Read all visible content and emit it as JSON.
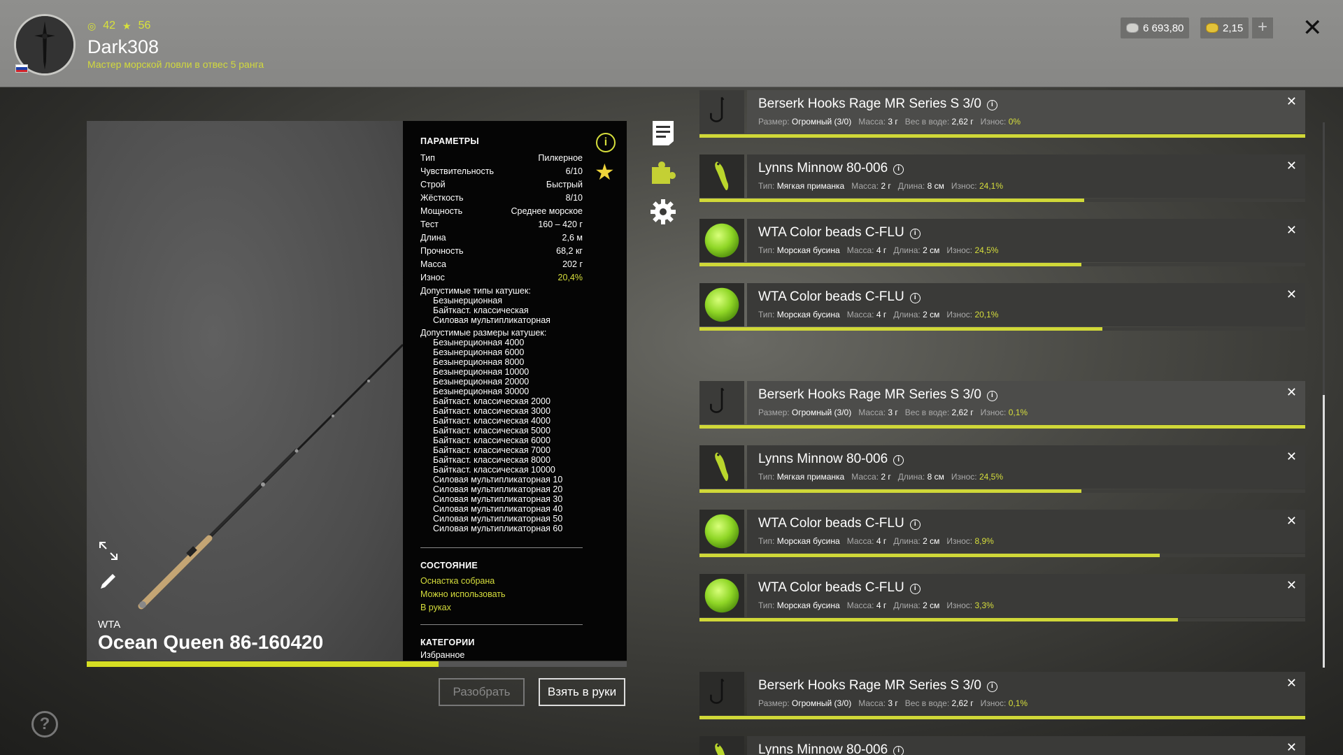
{
  "player": {
    "level": "42",
    "stars": "56",
    "name": "Dark308",
    "rank": "Мастер морской ловли в отвес 5 ранга"
  },
  "currency": {
    "silver": "6 693,80",
    "gold": "2,15"
  },
  "rod": {
    "brand": "WTA",
    "name": "Ocean Queen 86-160420",
    "progress": 0.652
  },
  "params": {
    "title": "ПАРАМЕТРЫ",
    "rows": [
      {
        "label": "Тип",
        "value": "Пилкерное"
      },
      {
        "label": "Чувствительность",
        "value": "6/10"
      },
      {
        "label": "Строй",
        "value": "Быстрый"
      },
      {
        "label": "Жёсткость",
        "value": "8/10"
      },
      {
        "label": "Мощность",
        "value": "Среднее морское"
      },
      {
        "label": "Тест",
        "value": "160 – 420 г"
      },
      {
        "label": "Длина",
        "value": "2,6 м"
      },
      {
        "label": "Прочность",
        "value": "68,2 кг"
      },
      {
        "label": "Масса",
        "value": "202 г"
      },
      {
        "label": "Износ",
        "value": "20,4%"
      }
    ],
    "reel_types_label": "Допустимые типы катушек:",
    "reel_types": [
      "Безынерционная",
      "Байткаст. классическая",
      "Силовая мультипликаторная"
    ],
    "reel_sizes_label": "Допустимые размеры катушек:",
    "reel_sizes": [
      "Безынерционная 4000",
      "Безынерционная 6000",
      "Безынерционная 8000",
      "Безынерционная 10000",
      "Безынерционная 20000",
      "Безынерционная 30000",
      "Байткаст. классическая 2000",
      "Байткаст. классическая 3000",
      "Байткаст. классическая 4000",
      "Байткаст. классическая 5000",
      "Байткаст. классическая 6000",
      "Байткаст. классическая 7000",
      "Байткаст. классическая 8000",
      "Байткаст. классическая 10000",
      "Силовая мультипликаторная 10",
      "Силовая мультипликаторная 20",
      "Силовая мультипликаторная 30",
      "Силовая мультипликаторная 40",
      "Силовая мультипликаторная 50",
      "Силовая мультипликаторная 60"
    ],
    "state_title": "СОСТОЯНИЕ",
    "state": [
      "Оснастка собрана",
      "Можно использовать",
      "В руках"
    ],
    "categories_title": "КАТЕГОРИИ",
    "categories": "Избранное"
  },
  "buttons": {
    "disassemble": "Разобрать",
    "take": "Взять в руки",
    "help": "?"
  },
  "items": [
    {
      "kind": "hook",
      "name": "Berserk Hooks Rage MR Series S 3/0",
      "m1": "Размер:",
      "v1": "Огромный (3/0)",
      "m2": "Масса:",
      "v2": "3 г",
      "m3": "Вес в воде:",
      "v3": "2,62 г",
      "m4": "Износ:",
      "v4": "0%",
      "progress": 1.0,
      "hl": true
    },
    {
      "kind": "minnow",
      "name": "Lynns Minnow 80-006",
      "m1": "Тип:",
      "v1": "Мягкая приманка",
      "m2": "Масса:",
      "v2": "2 г",
      "m3": "Длина:",
      "v3": "8 см",
      "m4": "Износ:",
      "v4": "24,1%",
      "progress": 0.635,
      "hl": false
    },
    {
      "kind": "bead",
      "name": "WTA Color beads C-FLU",
      "m1": "Тип:",
      "v1": "Морская бусина",
      "m2": "Масса:",
      "v2": "4 г",
      "m3": "Длина:",
      "v3": "2 см",
      "m4": "Износ:",
      "v4": "24,5%",
      "progress": 0.63,
      "hl": false
    },
    {
      "kind": "bead",
      "name": "WTA Color beads C-FLU",
      "m1": "Тип:",
      "v1": "Морская бусина",
      "m2": "Масса:",
      "v2": "4 г",
      "m3": "Длина:",
      "v3": "2 см",
      "m4": "Износ:",
      "v4": "20,1%",
      "progress": 0.665,
      "hl": false
    },
    {
      "kind": "hook",
      "name": "Berserk Hooks Rage MR Series S 3/0",
      "m1": "Размер:",
      "v1": "Огромный (3/0)",
      "m2": "Масса:",
      "v2": "3 г",
      "m3": "Вес в воде:",
      "v3": "2,62 г",
      "m4": "Износ:",
      "v4": "0,1%",
      "progress": 1.0,
      "hl": true
    },
    {
      "kind": "minnow",
      "name": "Lynns Minnow 80-006",
      "m1": "Тип:",
      "v1": "Мягкая приманка",
      "m2": "Масса:",
      "v2": "2 г",
      "m3": "Длина:",
      "v3": "8 см",
      "m4": "Износ:",
      "v4": "24,5%",
      "progress": 0.63,
      "hl": false
    },
    {
      "kind": "bead",
      "name": "WTA Color beads C-FLU",
      "m1": "Тип:",
      "v1": "Морская бусина",
      "m2": "Масса:",
      "v2": "4 г",
      "m3": "Длина:",
      "v3": "2 см",
      "m4": "Износ:",
      "v4": "8,9%",
      "progress": 0.76,
      "hl": false
    },
    {
      "kind": "bead",
      "name": "WTA Color beads C-FLU",
      "m1": "Тип:",
      "v1": "Морская бусина",
      "m2": "Масса:",
      "v2": "4 г",
      "m3": "Длина:",
      "v3": "2 см",
      "m4": "Износ:",
      "v4": "3,3%",
      "progress": 0.79,
      "hl": false
    },
    {
      "kind": "hook",
      "name": "Berserk Hooks Rage MR Series S 3/0",
      "m1": "Размер:",
      "v1": "Огромный (3/0)",
      "m2": "Масса:",
      "v2": "3 г",
      "m3": "Вес в воде:",
      "v3": "2,62 г",
      "m4": "Износ:",
      "v4": "0,1%",
      "progress": 1.0,
      "hl": false
    },
    {
      "kind": "minnow",
      "name": "Lynns Minnow 80-006",
      "m1": "",
      "v1": "",
      "m2": "",
      "v2": "",
      "m3": "",
      "v3": "",
      "m4": "",
      "v4": "",
      "progress": 0,
      "hl": false
    }
  ],
  "colors": {
    "accent": "#d6de3c",
    "gold": "#efd43a"
  }
}
